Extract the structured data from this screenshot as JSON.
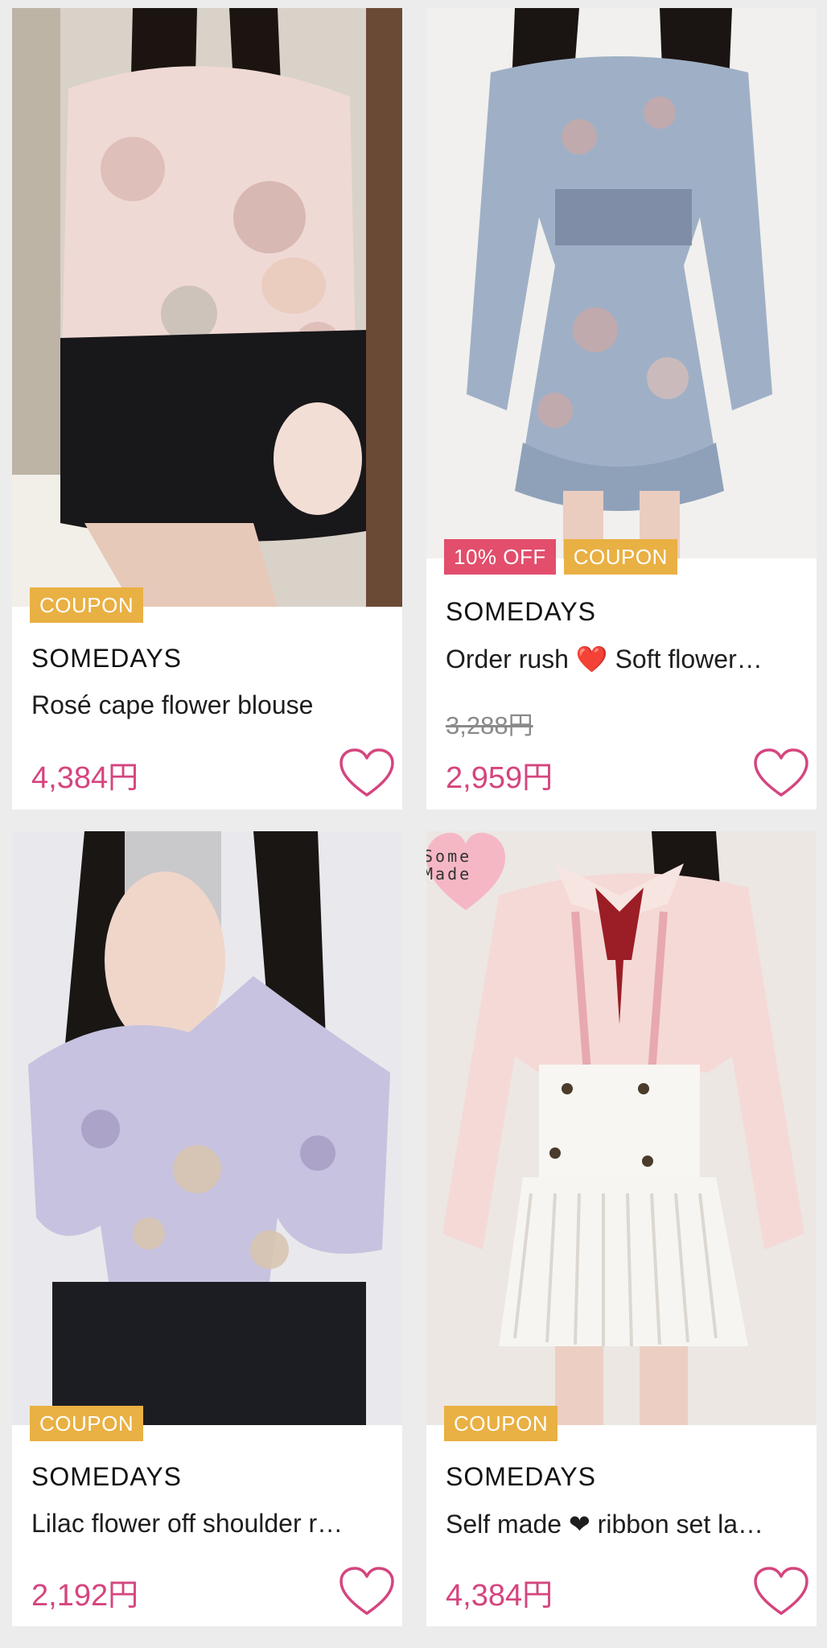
{
  "products": [
    {
      "badges": [
        {
          "text": "COUPON",
          "kind": "coupon"
        }
      ],
      "brand": "SOMEDAYS",
      "title": "Rosé cape flower blouse",
      "price": "4,384円"
    },
    {
      "badges": [
        {
          "text": "10% OFF",
          "kind": "off"
        },
        {
          "text": "COUPON",
          "kind": "coupon"
        }
      ],
      "brand": "SOMEDAYS",
      "title": "Order rush ❤️ Soft flower…",
      "old_price": "3,288円",
      "price": "2,959円"
    },
    {
      "badges": [
        {
          "text": "COUPON",
          "kind": "coupon"
        }
      ],
      "brand": "SOMEDAYS",
      "title": "Lilac flower off shoulder r…",
      "price": "2,192円"
    },
    {
      "badges": [
        {
          "text": "COUPON",
          "kind": "coupon"
        }
      ],
      "brand": "SOMEDAYS",
      "title": "Self made ❤ ribbon set la…",
      "price": "4,384円",
      "sticker": "Some Made"
    }
  ],
  "colors": {
    "price": "#d5457f",
    "coupon": "#e9b043",
    "discount": "#e24e6c",
    "heart": "#d5457f",
    "background": "#ececec"
  },
  "icons": {
    "favorite": "heart-outline-icon"
  }
}
